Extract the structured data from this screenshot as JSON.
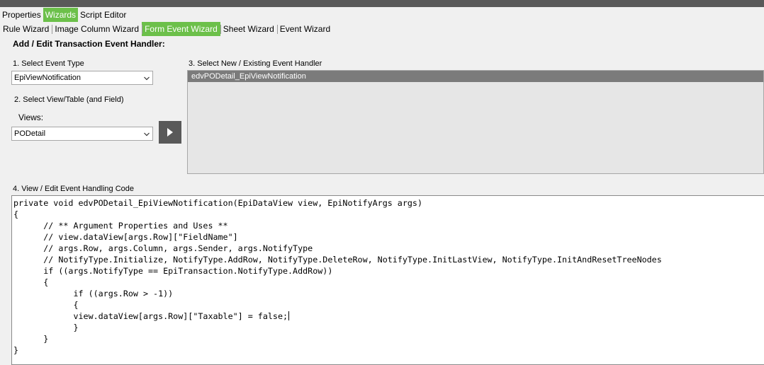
{
  "main_tabs": [
    {
      "label": "Properties",
      "active": false
    },
    {
      "label": "Wizards",
      "active": true
    },
    {
      "label": "Script Editor",
      "active": false
    }
  ],
  "sub_tabs": [
    {
      "label": "Rule Wizard",
      "active": false
    },
    {
      "label": "Image Column Wizard",
      "active": false
    },
    {
      "label": "Form Event Wizard",
      "active": true
    },
    {
      "label": "Sheet Wizard",
      "active": false
    },
    {
      "label": "Event Wizard",
      "active": false
    }
  ],
  "panel": {
    "heading": "Add / Edit Transaction Event Handler:",
    "event_type": {
      "label": "1. Select Event Type",
      "value": "EpiViewNotification"
    },
    "view_table": {
      "label": "2. Select View/Table (and Field)",
      "views_label": "Views:",
      "value": "PODetail"
    },
    "handler": {
      "label": "3. Select New / Existing Event Handler",
      "items": [
        "edvPODetail_EpiViewNotification"
      ]
    },
    "code": {
      "label": "4. View / Edit Event Handling Code",
      "lines": [
        "private void edvPODetail_EpiViewNotification(EpiDataView view, EpiNotifyArgs args)",
        "{",
        "\t// ** Argument Properties and Uses **",
        "\t// view.dataView[args.Row][\"FieldName\"]",
        "\t// args.Row, args.Column, args.Sender, args.NotifyType",
        "\t// NotifyType.Initialize, NotifyType.AddRow, NotifyType.DeleteRow, NotifyType.InitLastView, NotifyType.InitAndResetTreeNodes",
        "\tif ((args.NotifyType == EpiTransaction.NotifyType.AddRow))",
        "\t{",
        "\t\tif ((args.Row > -1))",
        "\t\t{",
        "\t\tview.dataView[args.Row][\"Taxable\"] = false;",
        "\t\t}",
        "\t}",
        "}"
      ]
    }
  },
  "colors": {
    "accent": "#6cc04a",
    "topbar": "#595959",
    "selection": "#7b7b7b"
  }
}
